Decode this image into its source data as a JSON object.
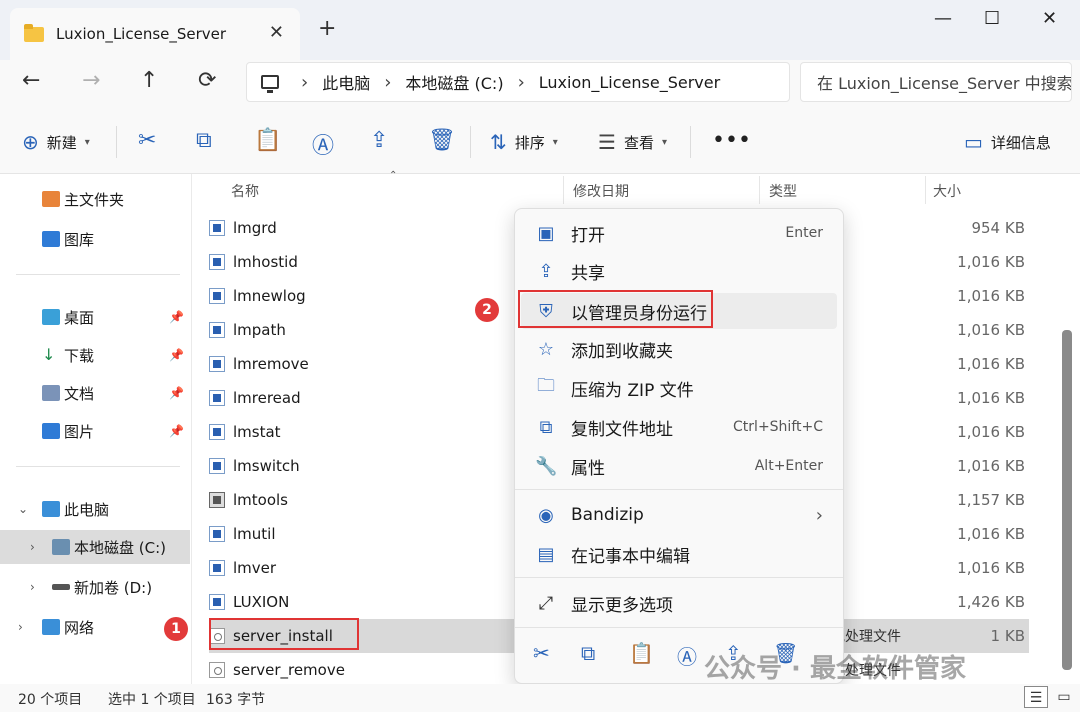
{
  "tab": {
    "title": "Luxion_License_Server",
    "close": "✕",
    "newtab": "+"
  },
  "window": {
    "minimize": "—",
    "maximize": "☐",
    "close": "✕"
  },
  "nav": {
    "back": "←",
    "forward": "→",
    "up": "↑",
    "refresh": "⟳"
  },
  "breadcrumb": [
    "此电脑",
    "本地磁盘 (C:)",
    "Luxion_License_Server"
  ],
  "breadcrumb_sep": "›",
  "search": {
    "placeholder": "在 Luxion_License_Server 中搜索"
  },
  "toolbar": {
    "new_label": "新建",
    "sort_label": "排序",
    "view_label": "查看",
    "more": "•••",
    "details_label": "详细信息"
  },
  "sidebar": {
    "items": [
      {
        "label": "主文件夹"
      },
      {
        "label": "图库"
      },
      {
        "label": "桌面"
      },
      {
        "label": "下载"
      },
      {
        "label": "文档"
      },
      {
        "label": "图片"
      },
      {
        "label": "此电脑"
      },
      {
        "label": "本地磁盘 (C:)"
      },
      {
        "label": "新加卷 (D:)"
      },
      {
        "label": "网络"
      }
    ]
  },
  "columns": {
    "name": "名称",
    "modified": "修改日期",
    "type": "类型",
    "size": "大小"
  },
  "files": [
    {
      "name": "lmgrd",
      "size": "954 KB",
      "type": ""
    },
    {
      "name": "lmhostid",
      "size": "1,016 KB",
      "type": ""
    },
    {
      "name": "lmnewlog",
      "size": "1,016 KB",
      "type": ""
    },
    {
      "name": "lmpath",
      "size": "1,016 KB",
      "type": ""
    },
    {
      "name": "lmremove",
      "size": "1,016 KB",
      "type": ""
    },
    {
      "name": "lmreread",
      "size": "1,016 KB",
      "type": ""
    },
    {
      "name": "lmstat",
      "size": "1,016 KB",
      "type": ""
    },
    {
      "name": "lmswitch",
      "size": "1,016 KB",
      "type": ""
    },
    {
      "name": "lmtools",
      "size": "1,157 KB",
      "type": ""
    },
    {
      "name": "lmutil",
      "size": "1,016 KB",
      "type": ""
    },
    {
      "name": "lmver",
      "size": "1,016 KB",
      "type": ""
    },
    {
      "name": "LUXION",
      "size": "1,426 KB",
      "type": ""
    },
    {
      "name": "server_install",
      "size": "1 KB",
      "type": "批处理文件"
    },
    {
      "name": "server_remove",
      "size": "",
      "type": "批处理文件"
    }
  ],
  "context_menu": {
    "items": [
      {
        "label": "打开",
        "shortcut": "Enter"
      },
      {
        "label": "共享",
        "shortcut": ""
      },
      {
        "label": "以管理员身份运行",
        "shortcut": ""
      },
      {
        "label": "添加到收藏夹",
        "shortcut": ""
      },
      {
        "label": "压缩为 ZIP 文件",
        "shortcut": ""
      },
      {
        "label": "复制文件地址",
        "shortcut": "Ctrl+Shift+C"
      },
      {
        "label": "属性",
        "shortcut": "Alt+Enter"
      },
      {
        "label": "Bandizip",
        "shortcut": ""
      },
      {
        "label": "在记事本中编辑",
        "shortcut": ""
      },
      {
        "label": "显示更多选项",
        "shortcut": ""
      }
    ]
  },
  "badges": {
    "one": "1",
    "two": "2"
  },
  "status": {
    "count": "20 个项目",
    "selected": "选中 1 个项目",
    "bytes": "163 字节"
  },
  "watermark": "公众号 · 最全软件管家",
  "colors": {
    "accent": "#2a64b8",
    "highlight": "#e03434",
    "selection": "#d9d9d9"
  }
}
